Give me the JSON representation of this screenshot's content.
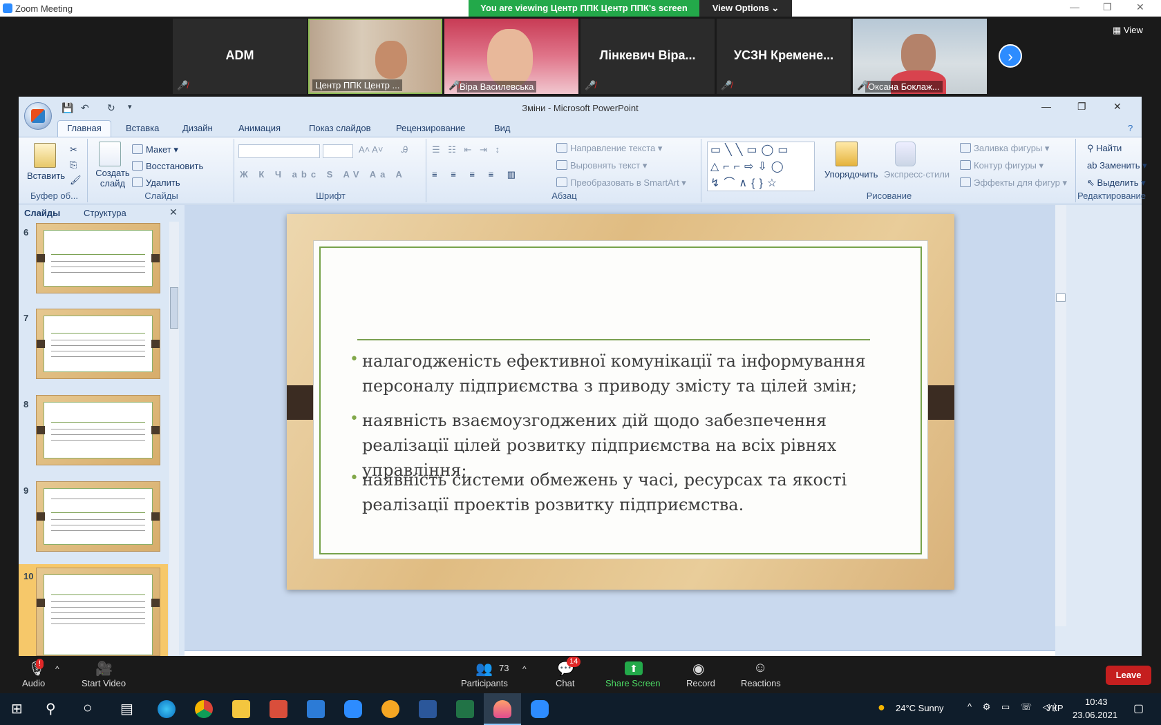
{
  "zoom": {
    "window_title": "Zoom Meeting",
    "viewing_banner": "You are viewing Центр ППК Центр ППК's screen",
    "view_options": "View Options ⌄",
    "view_label": "View",
    "participants_tiles": [
      {
        "name": "ADM",
        "type": "name"
      },
      {
        "name": "Центр ППК Центр ...",
        "type": "video"
      },
      {
        "name": "Віра Василевська",
        "type": "video"
      },
      {
        "name": "Лінкевич Віра...",
        "type": "name"
      },
      {
        "name": "УСЗН  Кременe...",
        "type": "name"
      },
      {
        "name": "Оксана Боклаж...",
        "type": "video"
      }
    ],
    "toolbar": {
      "audio": "Audio",
      "start_video": "Start Video",
      "participants": "Participants",
      "participants_count": "73",
      "chat": "Chat",
      "chat_badge": "14",
      "share_screen": "Share Screen",
      "record": "Record",
      "reactions": "Reactions",
      "leave": "Leave"
    }
  },
  "ppt": {
    "title": "Зміни - Microsoft PowerPoint",
    "tabs": [
      "Главная",
      "Вставка",
      "Дизайн",
      "Анимация",
      "Показ слайдов",
      "Рецензирование",
      "Вид"
    ],
    "groups": {
      "clipboard": "Буфер об...",
      "slides": "Слайды",
      "font": "Шрифт",
      "paragraph": "Абзац",
      "drawing": "Рисование",
      "editing": "Редактирование"
    },
    "buttons": {
      "paste": "Вставить",
      "new_slide": "Создать слайд",
      "layout": "Макет",
      "reset": "Восстановить",
      "delete": "Удалить",
      "text_direction": "Направление текста",
      "align_text": "Выровнять текст",
      "smartart": "Преобразовать в SmartArt",
      "arrange": "Упорядочить",
      "quick_styles": "Экспресс-стили",
      "shape_fill": "Заливка фигуры",
      "shape_outline": "Контур фигуры",
      "shape_effects": "Эффекты для фигур",
      "find": "Найти",
      "replace": "Заменить",
      "select": "Выделить"
    },
    "panel_tabs": [
      "Слайды",
      "Структура"
    ],
    "slide_numbers": [
      "6",
      "7",
      "8",
      "9",
      "10"
    ],
    "slide": {
      "bullets": [
        "налагодженість ефективної комунікації та інформування персоналу підприємства з приводу змісту та цілей змін;",
        "наявність взаємоузгоджених дій щодо забезпечення реалізації цілей розвитку підприємства на всіх рівнях управління;",
        "наявність системи  обмежень у часі, ресурсах та якості реалізації проектів розвитку підприємства."
      ]
    }
  },
  "taskbar": {
    "weather": "24°C  Sunny",
    "lang": "УКР",
    "time": "10:43",
    "date": "23.06.2021"
  }
}
